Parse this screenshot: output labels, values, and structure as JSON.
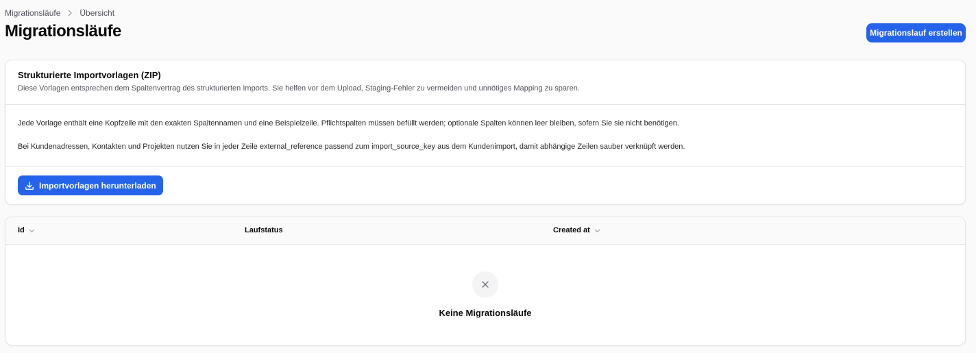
{
  "breadcrumb": {
    "parent": "Migrationsläufe",
    "current": "Übersicht"
  },
  "page": {
    "title": "Migrationsläufe",
    "create_button": "Migrationslauf erstellen"
  },
  "templates": {
    "title": "Strukturierte Importvorlagen (ZIP)",
    "description": "Diese Vorlagen entsprechen dem Spaltenvertrag des strukturierten Imports. Sie helfen vor dem Upload, Staging-Fehler zu vermeiden und unnötiges Mapping zu sparen.",
    "paragraph_1": "Jede Vorlage enthält eine Kopfzeile mit den exakten Spaltennamen und eine Beispielzeile. Pflichtspalten müssen befüllt werden; optionale Spalten können leer bleiben, sofern Sie sie nicht benötigen.",
    "paragraph_2": "Bei Kundenadressen, Kontakten und Projekten nutzen Sie in jeder Zeile external_reference passend zum import_source_key aus dem Kundenimport, damit abhängige Zeilen sauber verknüpft werden.",
    "download_button": "Importvorlagen herunterladen"
  },
  "table": {
    "columns": [
      {
        "label": "Id",
        "sortable": true
      },
      {
        "label": "Laufstatus",
        "sortable": false
      },
      {
        "label": "Created at",
        "sortable": true
      }
    ],
    "rows": [],
    "empty_text": "Keine Migrationsläufe"
  },
  "icons": {
    "breadcrumb_separator": "chevron-right-icon",
    "download": "download-icon",
    "sort": "chevron-down-icon",
    "empty": "close-icon"
  },
  "colors": {
    "accent": "#2563eb",
    "background": "#fafafa",
    "card": "#ffffff",
    "border": "#e4e4e7"
  }
}
